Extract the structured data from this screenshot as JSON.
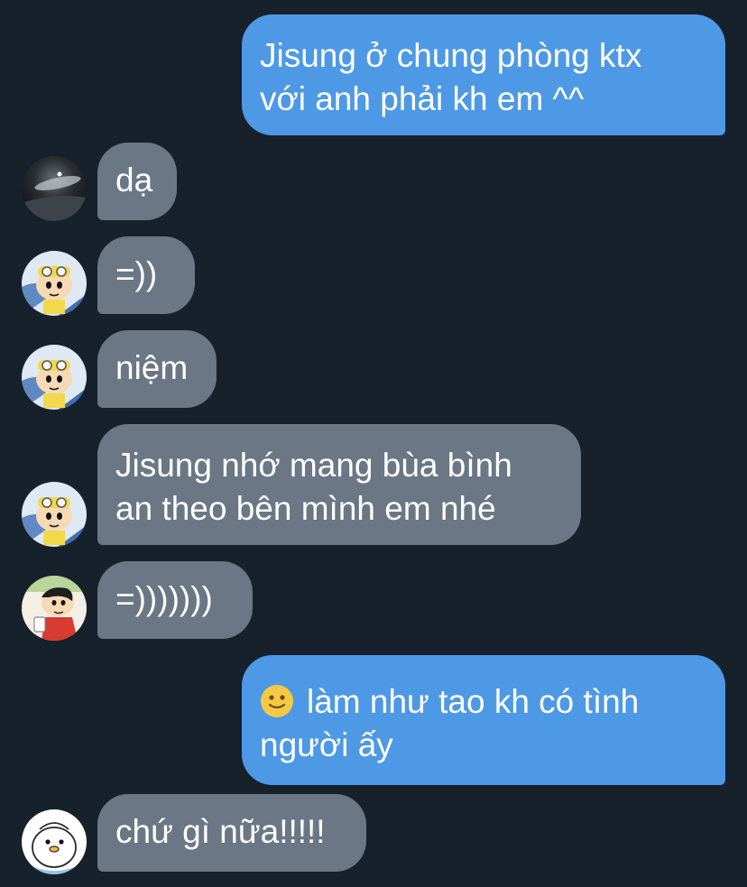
{
  "messages": [
    {
      "side": "out",
      "lines": [
        "Jisung ở chung phòng ktx",
        "với anh phải kh em ^^"
      ]
    },
    {
      "side": "in",
      "avatar": "space-photo-avatar",
      "text": "dạ"
    },
    {
      "side": "in",
      "avatar": "cartoon-boy-goggles-avatar",
      "text": "=))"
    },
    {
      "side": "in",
      "avatar": "cartoon-boy-goggles-avatar",
      "text": "niệm"
    },
    {
      "side": "in",
      "avatar": "cartoon-boy-goggles-avatar",
      "lines": [
        "Jisung nhớ mang bùa bình",
        "an theo bên mình em nhé"
      ]
    },
    {
      "side": "in",
      "avatar": "cartoon-boy-red-shirt-avatar",
      "text": "=)))))))"
    },
    {
      "side": "out",
      "emoji": "slightly-smiling-face",
      "lines": [
        "làm như tao kh có tình",
        "người ấy"
      ]
    },
    {
      "side": "in",
      "avatar": "cartoon-penguin-avatar",
      "text": "chứ gì nữa!!!!!"
    }
  ],
  "colors": {
    "background": "#17212b",
    "outgoing_bubble": "#4e99e5",
    "incoming_bubble": "#6b7785",
    "text": "#ffffff"
  }
}
